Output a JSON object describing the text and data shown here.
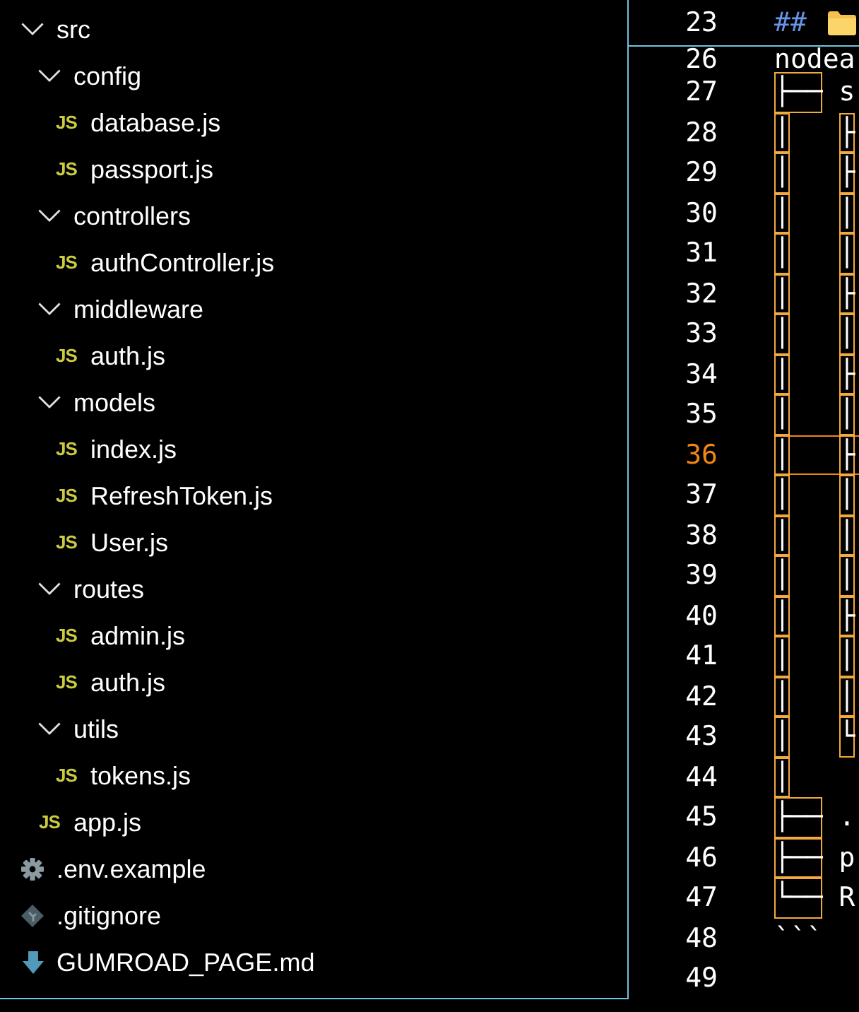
{
  "explorer": {
    "items": [
      {
        "kind": "folder",
        "name": "src",
        "expanded": true,
        "children": [
          {
            "kind": "folder",
            "name": "config",
            "expanded": true,
            "children": [
              {
                "kind": "js_file",
                "icon_label": "JS",
                "name": "database.js"
              },
              {
                "kind": "js_file",
                "icon_label": "JS",
                "name": "passport.js"
              }
            ]
          },
          {
            "kind": "folder",
            "name": "controllers",
            "expanded": true,
            "children": [
              {
                "kind": "js_file",
                "icon_label": "JS",
                "name": "authController.js"
              }
            ]
          },
          {
            "kind": "folder",
            "name": "middleware",
            "expanded": true,
            "children": [
              {
                "kind": "js_file",
                "icon_label": "JS",
                "name": "auth.js"
              }
            ]
          },
          {
            "kind": "folder",
            "name": "models",
            "expanded": true,
            "children": [
              {
                "kind": "js_file",
                "icon_label": "JS",
                "name": "index.js"
              },
              {
                "kind": "js_file",
                "icon_label": "JS",
                "name": "RefreshToken.js"
              },
              {
                "kind": "js_file",
                "icon_label": "JS",
                "name": "User.js"
              }
            ]
          },
          {
            "kind": "folder",
            "name": "routes",
            "expanded": true,
            "children": [
              {
                "kind": "js_file",
                "icon_label": "JS",
                "name": "admin.js"
              },
              {
                "kind": "js_file",
                "icon_label": "JS",
                "name": "auth.js"
              }
            ]
          },
          {
            "kind": "folder",
            "name": "utils",
            "expanded": true,
            "children": [
              {
                "kind": "js_file",
                "icon_label": "JS",
                "name": "tokens.js"
              }
            ]
          },
          {
            "kind": "js_file",
            "icon_label": "JS",
            "name": "app.js"
          }
        ]
      },
      {
        "kind": "settings_file",
        "name": ".env.example"
      },
      {
        "kind": "git_file",
        "name": ".gitignore"
      },
      {
        "kind": "markdown_file",
        "name": "GUMROAD_PAGE.md"
      }
    ]
  },
  "editor": {
    "sticky_line": {
      "number": "23",
      "segments": [
        {
          "kind": "heading_mark",
          "text": "##"
        },
        {
          "kind": "folder_icon"
        }
      ]
    },
    "lines": [
      {
        "number": "26",
        "current": false,
        "segments": [
          {
            "kind": "text",
            "text": "nodea"
          }
        ]
      },
      {
        "number": "27",
        "current": false,
        "segments": [
          {
            "kind": "box",
            "text": "├──"
          },
          {
            "kind": "text",
            "text": "s"
          }
        ]
      },
      {
        "number": "28",
        "current": false,
        "segments": [
          {
            "kind": "box",
            "text": "│"
          },
          {
            "kind": "box",
            "text": "├"
          }
        ]
      },
      {
        "number": "29",
        "current": false,
        "segments": [
          {
            "kind": "box",
            "text": "│"
          },
          {
            "kind": "box",
            "text": "├"
          }
        ]
      },
      {
        "number": "30",
        "current": false,
        "segments": [
          {
            "kind": "box",
            "text": "│"
          },
          {
            "kind": "box",
            "text": "│"
          }
        ]
      },
      {
        "number": "31",
        "current": false,
        "segments": [
          {
            "kind": "box",
            "text": "│"
          },
          {
            "kind": "box",
            "text": "│"
          }
        ]
      },
      {
        "number": "32",
        "current": false,
        "segments": [
          {
            "kind": "box",
            "text": "│"
          },
          {
            "kind": "box",
            "text": "├"
          }
        ]
      },
      {
        "number": "33",
        "current": false,
        "segments": [
          {
            "kind": "box",
            "text": "│"
          },
          {
            "kind": "box",
            "text": "│"
          }
        ]
      },
      {
        "number": "34",
        "current": false,
        "segments": [
          {
            "kind": "box",
            "text": "│"
          },
          {
            "kind": "box",
            "text": "├"
          }
        ]
      },
      {
        "number": "35",
        "current": false,
        "segments": [
          {
            "kind": "box",
            "text": "│"
          },
          {
            "kind": "box",
            "text": "│"
          }
        ]
      },
      {
        "number": "36",
        "current": true,
        "segments": [
          {
            "kind": "box",
            "text": "│"
          },
          {
            "kind": "box",
            "text": "├"
          }
        ]
      },
      {
        "number": "37",
        "current": false,
        "segments": [
          {
            "kind": "box",
            "text": "│"
          },
          {
            "kind": "box",
            "text": "│"
          }
        ]
      },
      {
        "number": "38",
        "current": false,
        "segments": [
          {
            "kind": "box",
            "text": "│"
          },
          {
            "kind": "box",
            "text": "│"
          }
        ]
      },
      {
        "number": "39",
        "current": false,
        "segments": [
          {
            "kind": "box",
            "text": "│"
          },
          {
            "kind": "box",
            "text": "│"
          }
        ]
      },
      {
        "number": "40",
        "current": false,
        "segments": [
          {
            "kind": "box",
            "text": "│"
          },
          {
            "kind": "box",
            "text": "├"
          }
        ]
      },
      {
        "number": "41",
        "current": false,
        "segments": [
          {
            "kind": "box",
            "text": "│"
          },
          {
            "kind": "box",
            "text": "│"
          }
        ]
      },
      {
        "number": "42",
        "current": false,
        "segments": [
          {
            "kind": "box",
            "text": "│"
          },
          {
            "kind": "box",
            "text": "│"
          }
        ]
      },
      {
        "number": "43",
        "current": false,
        "segments": [
          {
            "kind": "box",
            "text": "│"
          },
          {
            "kind": "box",
            "text": "└"
          }
        ]
      },
      {
        "number": "44",
        "current": false,
        "segments": [
          {
            "kind": "box",
            "text": "│"
          }
        ]
      },
      {
        "number": "45",
        "current": false,
        "segments": [
          {
            "kind": "box",
            "text": "├──"
          },
          {
            "kind": "text",
            "text": "."
          }
        ]
      },
      {
        "number": "46",
        "current": false,
        "segments": [
          {
            "kind": "box",
            "text": "├──"
          },
          {
            "kind": "text",
            "text": "p"
          }
        ]
      },
      {
        "number": "47",
        "current": false,
        "segments": [
          {
            "kind": "box",
            "text": "└──"
          },
          {
            "kind": "text",
            "text": "R"
          }
        ]
      },
      {
        "number": "48",
        "current": false,
        "segments": [
          {
            "kind": "text",
            "text": "```"
          }
        ]
      },
      {
        "number": "49",
        "current": false
      }
    ]
  }
}
